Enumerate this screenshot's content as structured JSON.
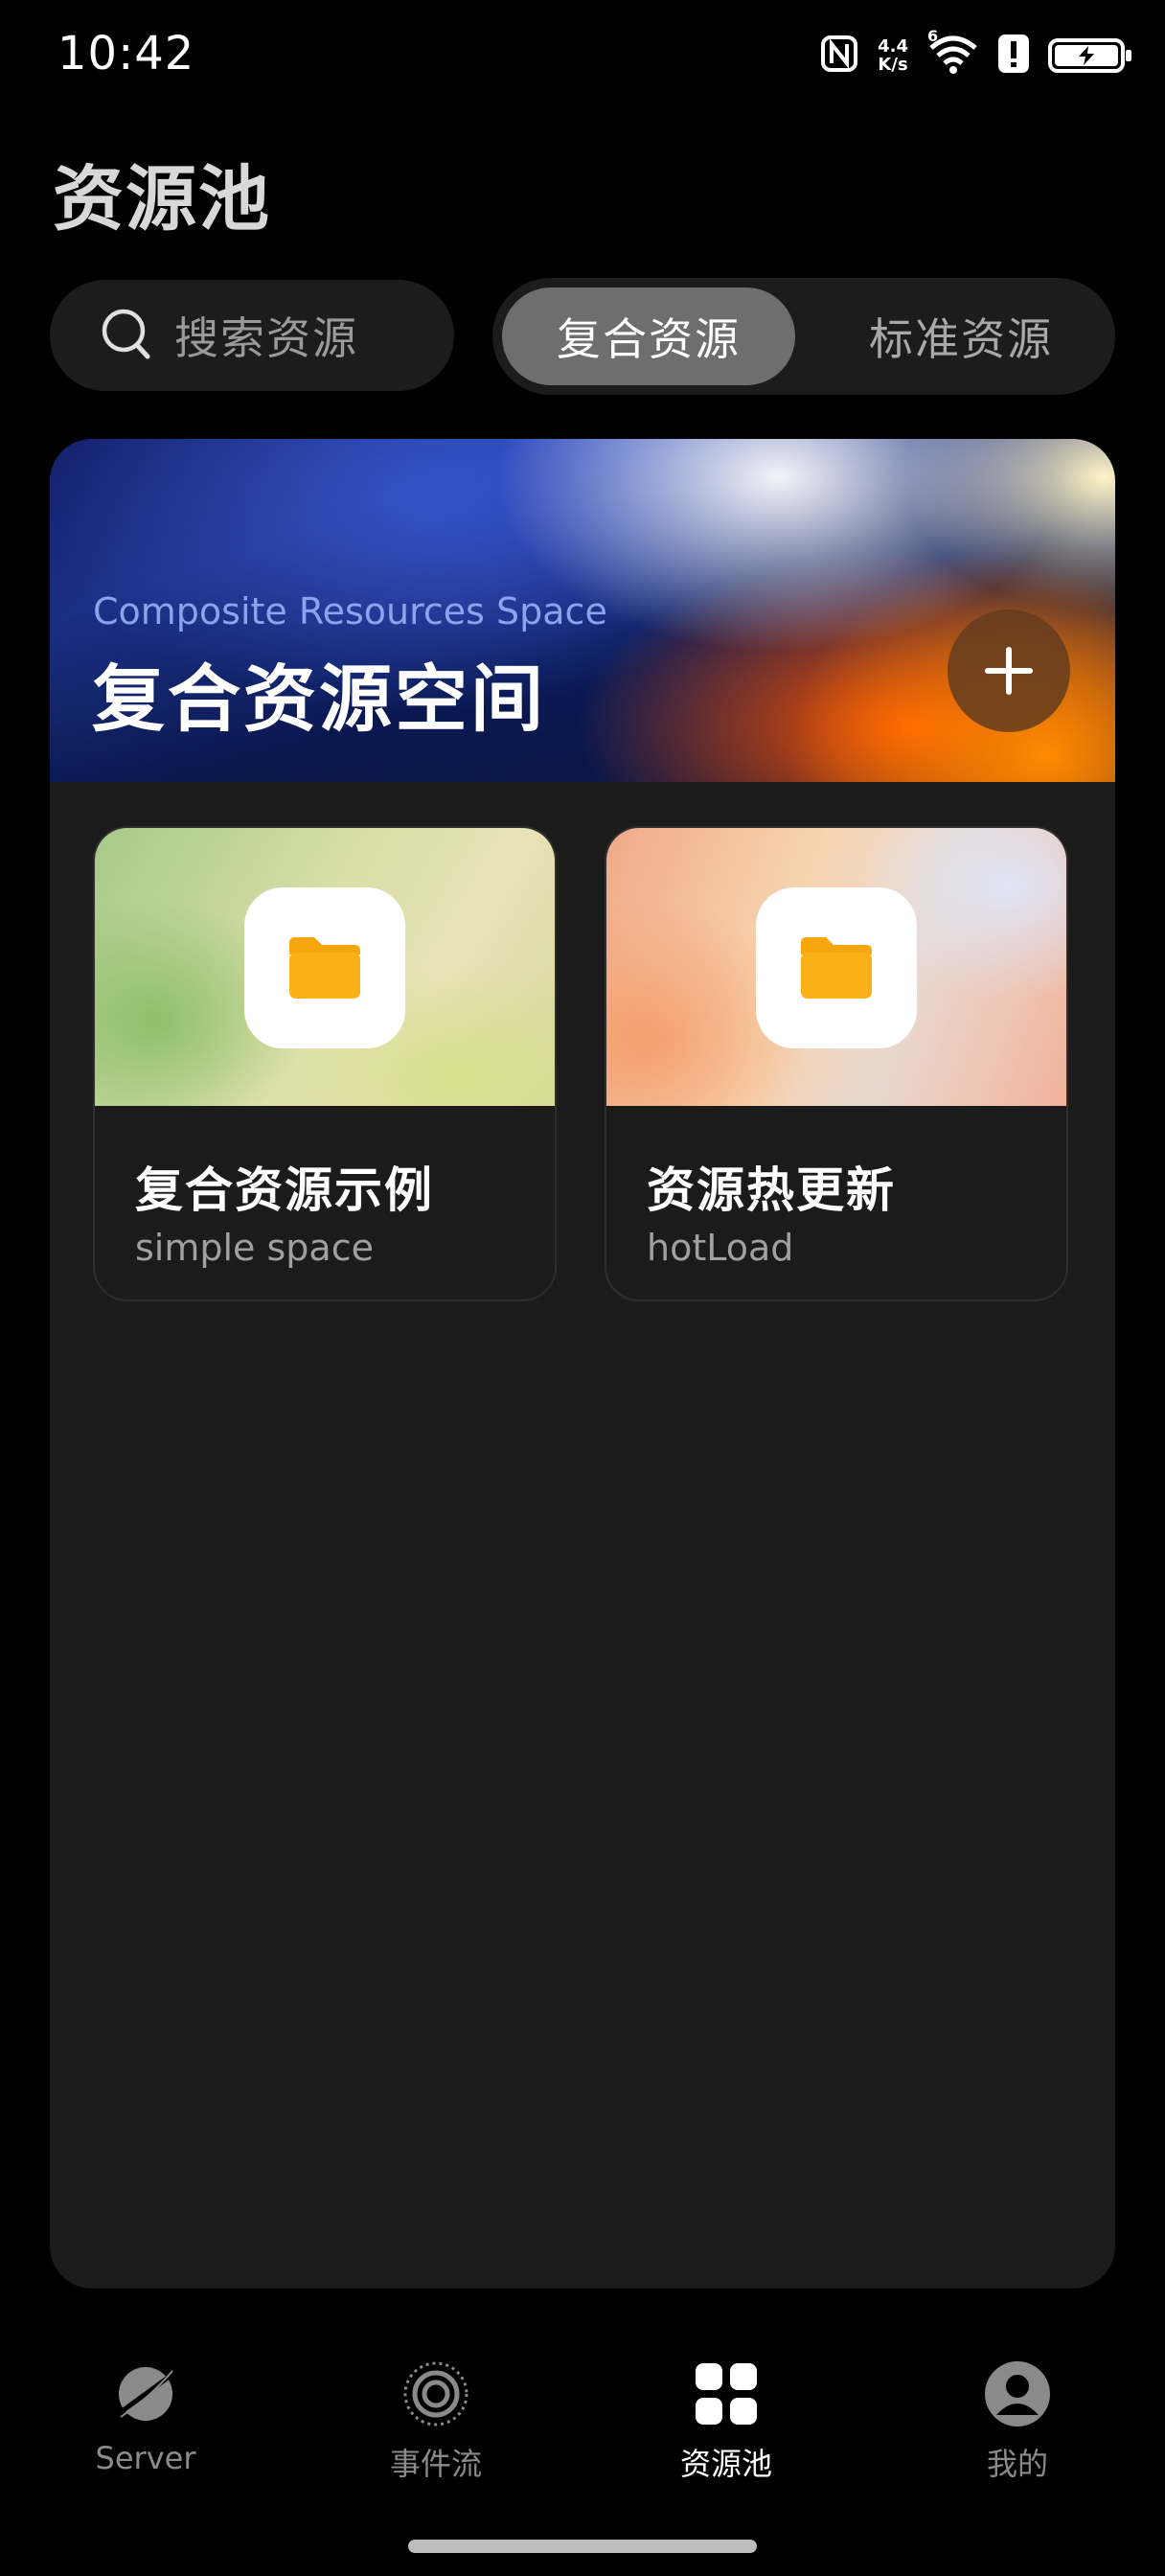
{
  "status_bar": {
    "time": "10:42",
    "net_speed_value": "4.4",
    "net_speed_unit": "K/s",
    "wifi_badge": "6"
  },
  "page": {
    "title": "资源池"
  },
  "search": {
    "placeholder": "搜索资源"
  },
  "segmented": {
    "active": "复合资源",
    "inactive": "标准资源"
  },
  "hero": {
    "subtitle": "Composite Resources Space",
    "title": "复合资源空间",
    "add_icon": "plus-icon"
  },
  "cards": [
    {
      "title": "复合资源示例",
      "subtitle": "simple space",
      "icon": "folder-icon"
    },
    {
      "title": "资源热更新",
      "subtitle": "hotLoad",
      "icon": "folder-icon"
    }
  ],
  "bottom_nav": [
    {
      "label": "Server",
      "icon": "planet-icon",
      "active": false
    },
    {
      "label": "事件流",
      "icon": "radar-icon",
      "active": false
    },
    {
      "label": "资源池",
      "icon": "grid-icon",
      "active": true
    },
    {
      "label": "我的",
      "icon": "person-icon",
      "active": false
    }
  ],
  "colors": {
    "background": "#000000",
    "panel": "#1b1b1b",
    "folder": "#fbb117",
    "segment_active": "#6e6e6e"
  }
}
